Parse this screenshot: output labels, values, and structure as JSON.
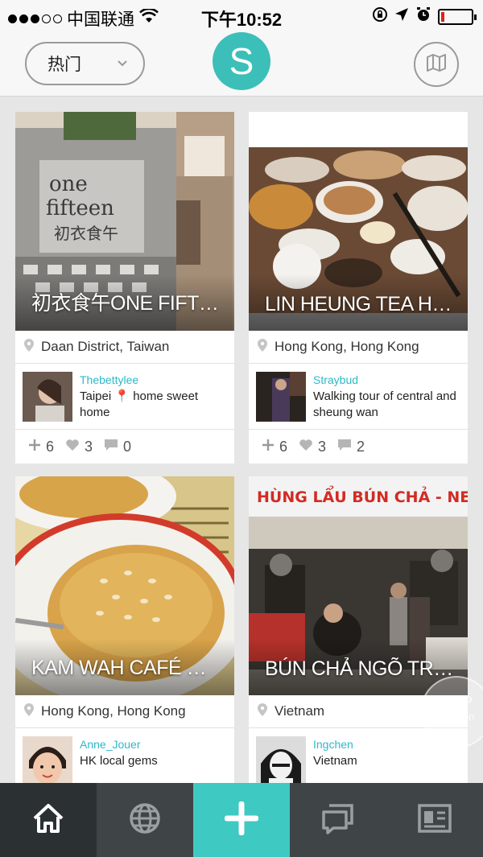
{
  "status_bar": {
    "carrier": "中国联通",
    "time": "下午10:52",
    "signal_bars_filled": 3,
    "signal_bars_total": 5,
    "battery_level": 0.1
  },
  "header": {
    "filter_label": "热门",
    "logo_letter": "S"
  },
  "cards": [
    {
      "title": "初衣食午ONE FIFTEEN",
      "location": "Daan District, Taiwan",
      "username": "Thebettylee",
      "description": "Taipei 📍 home sweet home",
      "adds": "6",
      "likes": "3",
      "comments": "0"
    },
    {
      "title": "LIN HEUNG TEA HOUSE...",
      "location": "Hong Kong, Hong Kong",
      "username": "Straybud",
      "description": "Walking tour of central and sheung wan",
      "adds": "6",
      "likes": "3",
      "comments": "2"
    },
    {
      "title": "KAM WAH CAFÉ 金華...",
      "location": "Hong Kong, Hong Kong",
      "username": "Anne_Jouer",
      "description": "HK local gems"
    },
    {
      "title": "BÚN CHẢ NGÕ TRẠM",
      "location": "Vietnam",
      "username": "Ingchen",
      "description": "Vietnam",
      "sign_text": "HÙNG LẨU BÚN CHẢ - NEM"
    }
  ],
  "watermark": {
    "line1": "APP",
    "line2": "solution"
  },
  "colors": {
    "accent": "#3ec9c2",
    "link": "#2eb8c8",
    "tabbar": "#3f4447"
  }
}
